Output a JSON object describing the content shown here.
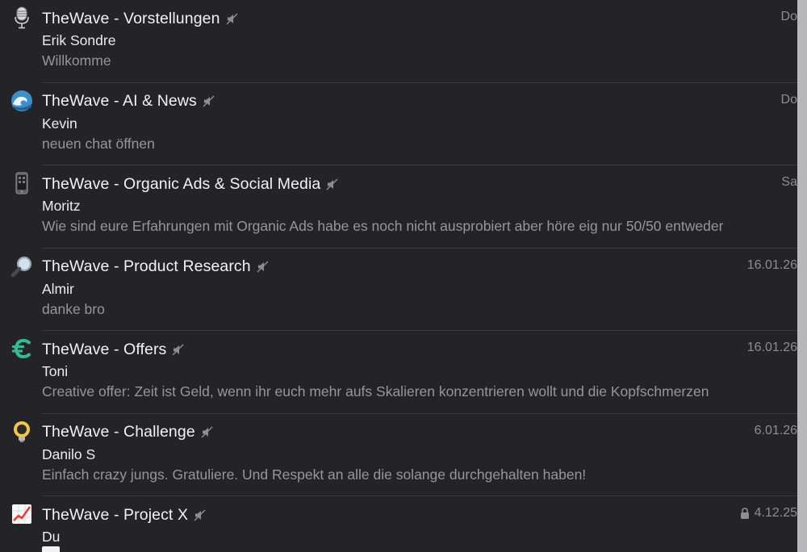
{
  "chats": [
    {
      "icon": "microphone-icon",
      "title": "TheWave - Vorstellungen",
      "sender": "Erik Sondre",
      "preview": "Willkomme",
      "date": "Do",
      "muted": true,
      "locked": false
    },
    {
      "icon": "wave-icon",
      "title": "TheWave - AI & News",
      "sender": "Kevin",
      "preview": "neuen chat öffnen",
      "date": "Do",
      "muted": true,
      "locked": false
    },
    {
      "icon": "phone-icon",
      "title": "TheWave - Organic Ads & Social Media",
      "sender": "Moritz",
      "preview": "Wie sind eure Erfahrungen mit Organic Ads habe es noch nicht ausprobiert aber höre eig nur 50/50 entweder",
      "date": "Sa",
      "muted": true,
      "locked": false
    },
    {
      "icon": "magnifier-icon",
      "title": "TheWave - Product Research",
      "sender": "Almir",
      "preview": "danke bro",
      "date": "16.01.26",
      "muted": true,
      "locked": false
    },
    {
      "icon": "euro-icon",
      "title": "TheWave - Offers",
      "sender": "Toni",
      "preview": "Creative offer:  Zeit ist Geld, wenn ihr euch mehr aufs Skalieren konzentrieren wollt und die Kopfschmerzen",
      "date": "16.01.26",
      "muted": true,
      "locked": false
    },
    {
      "icon": "lightbulb-icon",
      "title": "TheWave - Challenge",
      "sender": "Danilo S",
      "preview": "Einfach crazy jungs. Gratuliere. Und Respekt an alle die solange durchgehalten haben!",
      "date": "6.01.26",
      "muted": true,
      "locked": false
    },
    {
      "icon": "chart-increasing-icon",
      "title": "TheWave - Project X",
      "sender": "Du",
      "preview": "",
      "date": "4.12.25",
      "muted": true,
      "locked": true
    }
  ],
  "colors": {
    "background": "#242426",
    "title": "#f2f2f4",
    "secondary": "#96969b",
    "separator": "#3a3a3d",
    "scrollbar": "#b8b8bc"
  }
}
